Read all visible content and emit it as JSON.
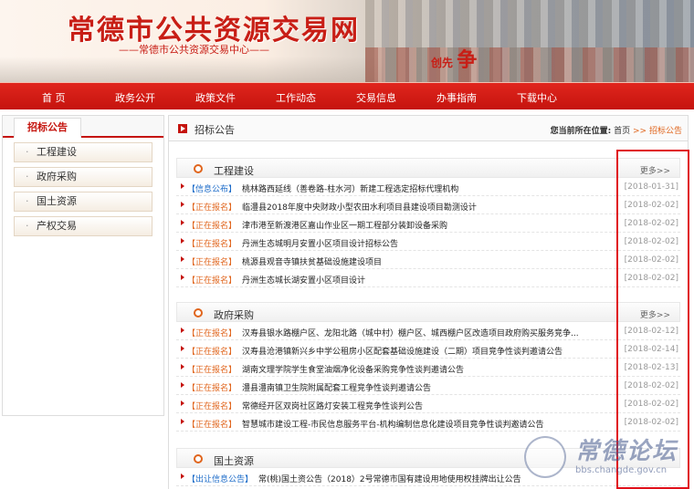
{
  "header": {
    "site_title": "常德市公共资源交易网",
    "site_subtitle": "——常德市公共资源交易中心——",
    "slogan_small": "创先",
    "slogan_big": "争"
  },
  "nav": [
    "首 页",
    "政务公开",
    "政策文件",
    "工作动态",
    "交易信息",
    "办事指南",
    "下载中心"
  ],
  "sidebar": {
    "title": "招标公告",
    "items": [
      "工程建设",
      "政府采购",
      "国土资源",
      "产权交易"
    ]
  },
  "main": {
    "title": "招标公告",
    "breadcrumb_label": "您当前所在位置:",
    "breadcrumb_home": "首页",
    "breadcrumb_sep": ">>",
    "breadcrumb_current": "招标公告",
    "more_label": "更多>>"
  },
  "sections": [
    {
      "name": "工程建设",
      "rows": [
        {
          "tag": "【信息公布】",
          "tag_color": "#1a6ac8",
          "text": "桃林路西延线（善卷路-柱水河）新建工程选定招标代理机构",
          "date": "[2018-01-31]"
        },
        {
          "tag": "【正在报名】",
          "tag_color": "#e0651d",
          "text": "临澧县2018年度中央财政小型农田水利项目县建设项目勘测设计",
          "date": "[2018-02-02]"
        },
        {
          "tag": "【正在报名】",
          "tag_color": "#e0651d",
          "text": "津市港至新渡港区嘉山作业区一期工程部分装卸设备采购",
          "date": "[2018-02-02]"
        },
        {
          "tag": "【正在报名】",
          "tag_color": "#e0651d",
          "text": "丹洲生态城明月安置小区项目设计招标公告",
          "date": "[2018-02-02]"
        },
        {
          "tag": "【正在报名】",
          "tag_color": "#e0651d",
          "text": "桃源县观音寺镇扶贫基础设施建设项目",
          "date": "[2018-02-02]"
        },
        {
          "tag": "【正在报名】",
          "tag_color": "#e0651d",
          "text": "丹洲生态城长湖安置小区项目设计",
          "date": "[2018-02-02]"
        }
      ]
    },
    {
      "name": "政府采购",
      "rows": [
        {
          "tag": "【正在报名】",
          "tag_color": "#e0651d",
          "text": "汉寿县银水路棚户区、龙阳北路（城中村）棚户区、城西棚户区改造项目政府购买服务竞争...",
          "date": "[2018-02-12]"
        },
        {
          "tag": "【正在报名】",
          "tag_color": "#e0651d",
          "text": "汉寿县沧港镇新兴乡中学公租房小区配套基础设施建设（二期）项目竞争性谈判邀请公告",
          "date": "[2018-02-14]"
        },
        {
          "tag": "【正在报名】",
          "tag_color": "#e0651d",
          "text": "湖南文理学院学生食堂油烟净化设备采购竞争性谈判邀请公告",
          "date": "[2018-02-13]"
        },
        {
          "tag": "【正在报名】",
          "tag_color": "#e0651d",
          "text": "澧县澧南镇卫生院附属配套工程竞争性谈判邀请公告",
          "date": "[2018-02-02]"
        },
        {
          "tag": "【正在报名】",
          "tag_color": "#e0651d",
          "text": "常德经开区双岗社区路灯安装工程竞争性谈判公告",
          "date": "[2018-02-02]"
        },
        {
          "tag": "【正在报名】",
          "tag_color": "#e0651d",
          "text": "智慧城市建设工程-市民信息服务平台-机构编制信息化建设项目竞争性谈判邀请公告",
          "date": "[2018-02-02]"
        }
      ]
    },
    {
      "name": "国土资源",
      "rows": [
        {
          "tag": "【出让信息公告】",
          "tag_color": "#1a6ac8",
          "text": "常(桃)国土资公告（2018）2号常德市国有建设用地使用权挂牌出让公告",
          "date": ""
        }
      ]
    }
  ],
  "watermark": {
    "text": "常德论坛",
    "url": "bbs.changde.gov.cn"
  },
  "colors": {
    "primary_red": "#c5140e",
    "tag_orange": "#e0651d",
    "tag_blue": "#1a6ac8",
    "highlight_box": "#e0101a"
  }
}
